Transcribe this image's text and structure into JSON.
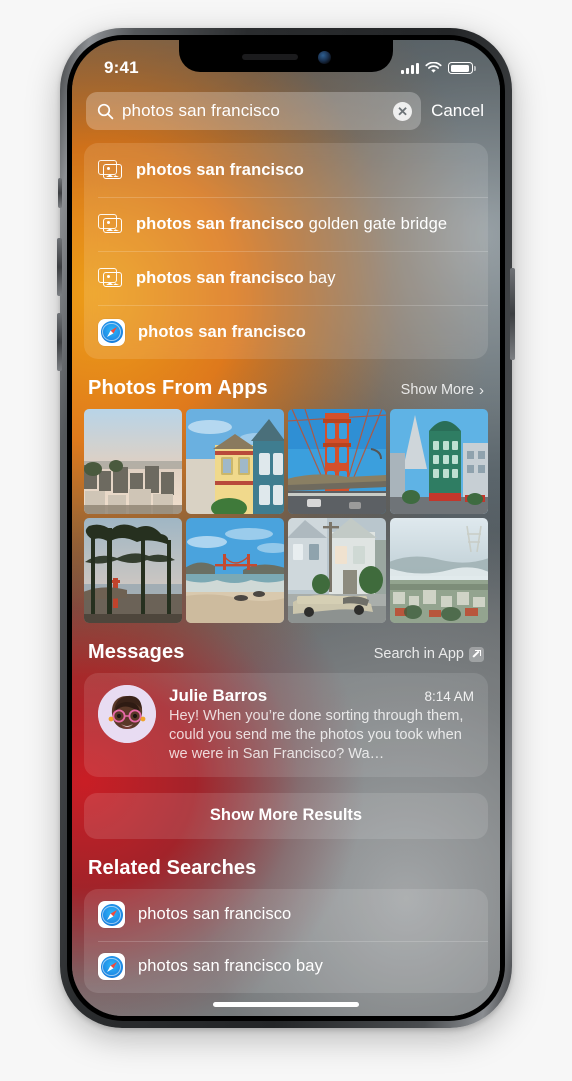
{
  "status_bar": {
    "time": "9:41",
    "signal_icon": "cellular-bars-icon",
    "wifi_icon": "wifi-icon",
    "battery_icon": "battery-icon"
  },
  "search": {
    "icon": "search-icon",
    "value": "photos san francisco",
    "placeholder": "Search",
    "clear_label": "✕",
    "cancel_label": "Cancel"
  },
  "suggestions": [
    {
      "icon": "photos-stack-icon",
      "bold": "photos san francisco",
      "rest": ""
    },
    {
      "icon": "photos-stack-icon",
      "bold": "photos san francisco",
      "rest": " golden gate bridge"
    },
    {
      "icon": "photos-stack-icon",
      "bold": "photos san francisco",
      "rest": " bay"
    },
    {
      "icon": "safari-icon",
      "bold": "photos san francisco",
      "rest": ""
    }
  ],
  "photos_section": {
    "title": "Photos From Apps",
    "action_label": "Show More",
    "chevron": "›",
    "thumbnails": [
      {
        "alt": "san-francisco-cityscape-from-hill"
      },
      {
        "alt": "victorian-painted-ladies-houses"
      },
      {
        "alt": "golden-gate-bridge-roadway-tower"
      },
      {
        "alt": "transamerica-pyramid-columbus-tower"
      },
      {
        "alt": "golden-gate-bridge-through-cypress-trees"
      },
      {
        "alt": "baker-beach-golden-gate-bridge"
      },
      {
        "alt": "steep-street-house-with-parked-car"
      },
      {
        "alt": "sutro-tower-fog-over-city"
      }
    ]
  },
  "messages_section": {
    "title": "Messages",
    "action_label": "Search in App",
    "action_icon": "external-link-icon",
    "message": {
      "avatar": "memoji-avatar",
      "sender": "Julie Barros",
      "time": "8:14 AM",
      "preview": "Hey! When you’re done sorting through them, could you send me the photos you took when we were in San Francisco? Wa…"
    }
  },
  "show_more_results": {
    "label": "Show More Results"
  },
  "related_section": {
    "title": "Related Searches",
    "items": [
      {
        "icon": "safari-icon",
        "label": "photos san francisco"
      },
      {
        "icon": "safari-icon",
        "label": "photos san francisco bay"
      }
    ]
  },
  "colors": {
    "accent_orange": "#e07a1c",
    "accent_red": "#cf1f26",
    "slate": "#46525a",
    "safari_blue": "#1f8fe8"
  }
}
